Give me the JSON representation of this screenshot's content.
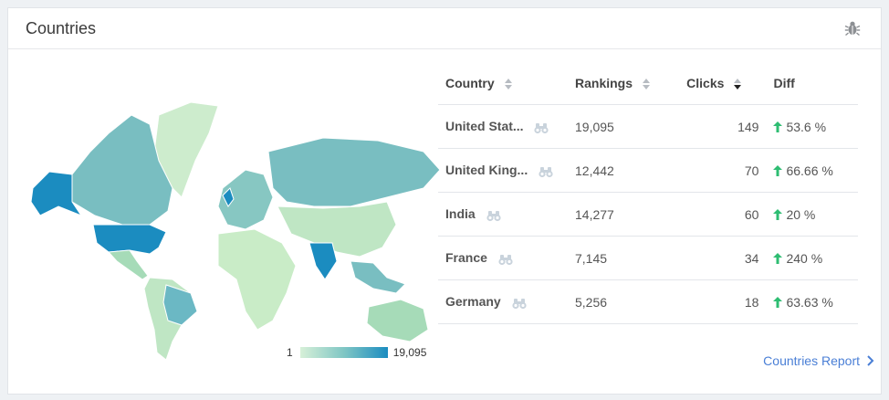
{
  "header": {
    "title": "Countries",
    "settings_icon": "bug-icon"
  },
  "legend": {
    "min_label": "1",
    "max_label": "19,095",
    "colors": [
      "#d7f0d8",
      "#7fc6c4",
      "#1b8cc0"
    ]
  },
  "table": {
    "columns": {
      "country": "Country",
      "rankings": "Rankings",
      "clicks": "Clicks",
      "diff": "Diff"
    },
    "sorted_by": "Clicks",
    "rows": [
      {
        "country": "United Stat...",
        "rankings": "19,095",
        "clicks": "149",
        "diff": "53.6 %"
      },
      {
        "country": "United King...",
        "rankings": "12,442",
        "clicks": "70",
        "diff": "66.66 %"
      },
      {
        "country": "India",
        "rankings": "14,277",
        "clicks": "60",
        "diff": "20 %"
      },
      {
        "country": "France",
        "rankings": "7,145",
        "clicks": "34",
        "diff": "240 %"
      },
      {
        "country": "Germany",
        "rankings": "5,256",
        "clicks": "18",
        "diff": "63.63 %"
      }
    ]
  },
  "footer": {
    "report_link": "Countries Report"
  },
  "colors": {
    "accent_link": "#4a7fd6",
    "positive_diff": "#2ebd72",
    "map_highlight": "#1b8cc0"
  }
}
